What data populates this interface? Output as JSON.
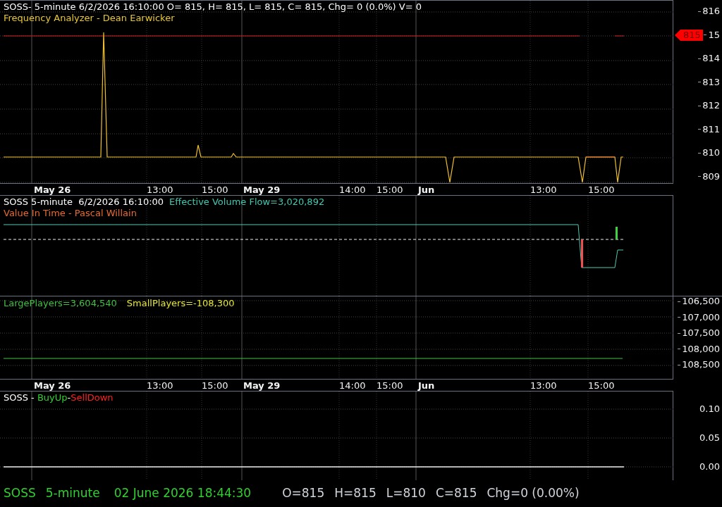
{
  "price_pane": {
    "header": "SOSS- 5-minute 6/2/2026 16:10:00 O= 815, H= 815, L= 815, C= 815, Chg= 0 (0.0%) V= 0",
    "indicator": "Frequency Analyzer - Dean Earwicker",
    "yticks": [
      "816",
      "15",
      "814",
      "813",
      "812",
      "811",
      "810",
      "809"
    ],
    "price_tag": "815"
  },
  "time_axis_top": [
    "May 26",
    "13:00",
    "15:00",
    "May 29",
    "14:00",
    "15:00",
    "Jun",
    "13:00",
    "15:00"
  ],
  "volume_pane": {
    "header": "SOSS 5-minute  6/2/2026 16:10:00",
    "reading": "Effective Volume Flow=3,020,892",
    "indicator": "Value In Time - Pascal Willain"
  },
  "players_pane": {
    "large": "LargePlayers=3,604,540",
    "small": "SmallPlayers=-108,300",
    "yticks": [
      "106,500",
      "107,000",
      "107,500",
      "108,000",
      "108,500"
    ]
  },
  "time_axis_bottom": [
    "May 26",
    "13:00",
    "15:00",
    "May 29",
    "14:00",
    "15:00",
    "Jun",
    "13:00",
    "15:00"
  ],
  "buy_pane": {
    "symbol": "SOSS - ",
    "buy": "BuyUp",
    "separator": "-",
    "sell": "SellDown",
    "yticks": [
      "0.10",
      "0.05",
      "0.00"
    ]
  },
  "status_bar": {
    "symbol": "SOSS",
    "interval": "5-minute",
    "datetime": "02 June 2026 18:44:30",
    "open": "O=815",
    "high": "H=815",
    "low": "L=810",
    "close": "C=815",
    "change": "Chg=0 (0.00%)"
  }
}
